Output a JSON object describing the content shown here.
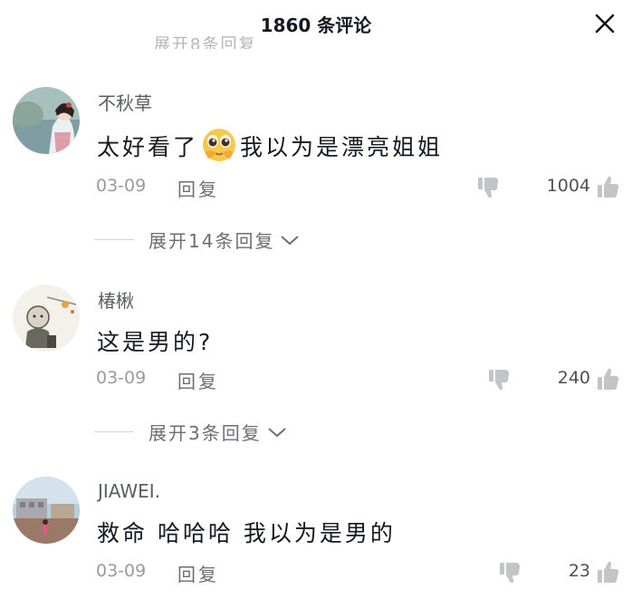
{
  "header": {
    "title": "1860 条评论"
  },
  "cutoff_text": "展开8条回复",
  "comments": [
    {
      "username": "不秋草",
      "text_before": "太好看了",
      "emoji": "pleading-face-emoji",
      "text_after": "我以为是漂亮姐姐",
      "date": "03-09",
      "reply_label": "回复",
      "likes": "1004",
      "expand_label": "展开14条回复"
    },
    {
      "username": "椿楸",
      "text": "这是男的?",
      "date": "03-09",
      "reply_label": "回复",
      "likes": "240",
      "expand_label": "展开3条回复"
    },
    {
      "username": "JIAWEI.",
      "text": "救命 哈哈哈 我以为是男的",
      "date": "03-09",
      "reply_label": "回复",
      "likes": "23"
    }
  ],
  "colors": {
    "text_primary": "#161823",
    "text_secondary": "#9a9ba0",
    "icon_gray": "#c3c4c8"
  }
}
